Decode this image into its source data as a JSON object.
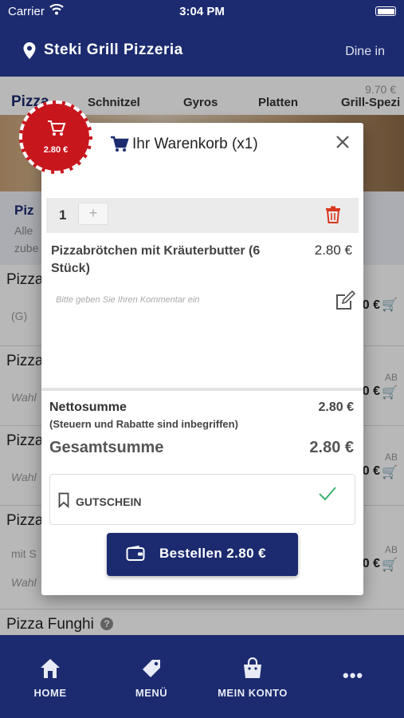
{
  "status_bar": {
    "carrier": "Carrier",
    "time": "3:04 PM"
  },
  "header": {
    "title": "Steki Grill Pizzeria",
    "mode": "Dine in"
  },
  "tabs": [
    {
      "label": "Pizza"
    },
    {
      "label": "Schnitzel"
    },
    {
      "label": "Gyros"
    },
    {
      "label": "Platten"
    },
    {
      "label": "Grill-Spezi"
    }
  ],
  "cart_summary_price": "9.70 €",
  "category": {
    "title": "Piz",
    "desc_line1": "Alle",
    "desc_line2": "zube"
  },
  "background_items": [
    {
      "name": "Pizza",
      "sub": "(G)",
      "price": "0 €",
      "ab": ""
    },
    {
      "name": "Pizza",
      "sub": "Wahl",
      "price": "0 €",
      "ab": "AB"
    },
    {
      "name": "Pizza",
      "sub": "Wahl",
      "price": "0 €",
      "ab": "AB"
    },
    {
      "name": "Pizza",
      "sub": "mit S",
      "sub2": "Wahl",
      "price": "0 €",
      "ab": "AB"
    },
    {
      "name": "Pizza Funghi"
    }
  ],
  "badge": {
    "price": "2.80 €"
  },
  "modal": {
    "title": "Ihr Warenkorb (x1)",
    "quantity": "1",
    "plus": "+",
    "product_name": "Pizzabrötchen mit Kräuterbutter (6 Stück)",
    "product_price": "2.80 €",
    "comment_placeholder": "Bitte geben Sie Ihren Kommentar ein",
    "net_label": "Nettosumme",
    "net_value": "2.80 €",
    "net_sub": "(Steuern und Rabatte sind inbegriffen)",
    "total_label": "Gesamtsumme",
    "total_value": "2.80 €",
    "voucher_label": "GUTSCHEIN",
    "order_button": "Bestellen 2.80 €"
  },
  "bottom_nav": [
    {
      "label": "HOME"
    },
    {
      "label": "MENÜ"
    },
    {
      "label": "MEIN KONTO"
    }
  ],
  "colors": {
    "primary": "#1c2b6f",
    "accent_red": "#c8161d",
    "check_green": "#3cb371"
  }
}
